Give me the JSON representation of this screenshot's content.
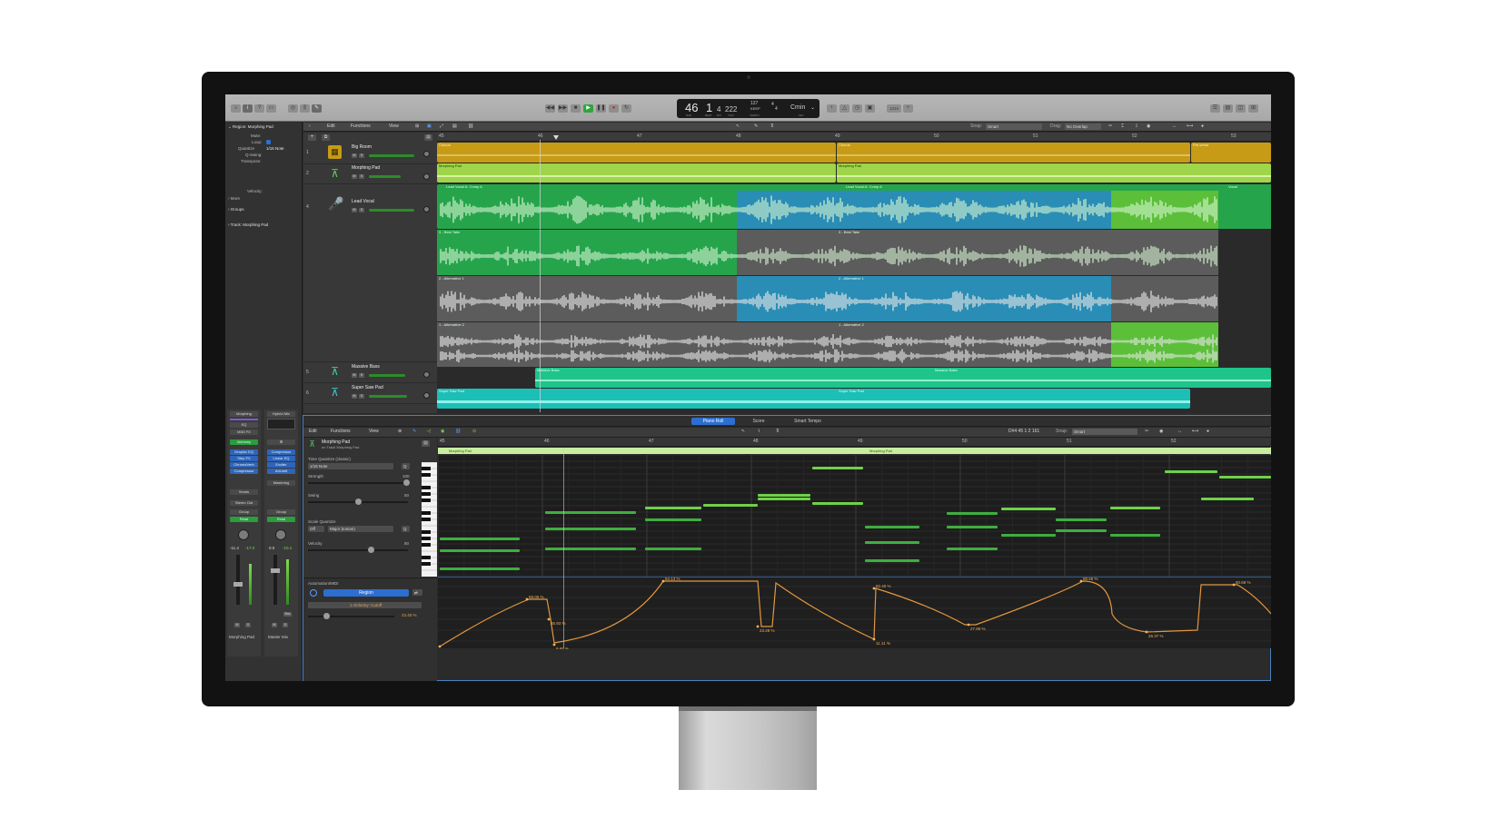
{
  "colors": {
    "accent": "#2d6ed1",
    "chorus": "#c79b16",
    "morph": "#9ed54a",
    "vocal_green": "#26a44c",
    "vocal_blue": "#2a8db5",
    "bass": "#1fc48a",
    "supersaw": "#1bbfb6"
  },
  "control_bar": {
    "position": {
      "bars": "46",
      "beats": "1",
      "div": "4",
      "ticks": "222"
    },
    "position_labels": {
      "bar": "BAR",
      "beat": "BEAT",
      "div": "DIV",
      "tick": "TICK"
    },
    "tempo": "127",
    "tempo_mode": "KEEP",
    "tempo_label": "TEMPO",
    "signature_top": "4",
    "signature_bottom": "4",
    "key": "Cmin",
    "key_label": "KEY",
    "cpu": "1234"
  },
  "tracks_toolbar": {
    "edit": "Edit",
    "functions": "Functions",
    "view": "View",
    "snap_label": "Snap:",
    "snap": "Smart",
    "drag_label": "Drag:",
    "drag": "No Overlap"
  },
  "inspector": {
    "region_header": "Region: Morphing Pad",
    "rows": [
      "Mute:",
      "Loop:",
      "Quantize",
      "Q-Swing:",
      "Transpose:",
      "Velocity:"
    ],
    "quantize_value": "1/16 Note",
    "more": "More",
    "groups": "Groups",
    "track_header": "Track: Morphing Pad"
  },
  "channel_strips": [
    {
      "setting": "Morphing",
      "eq": "EQ",
      "midi_fx": "MIDI FX",
      "instrument": "Alchemy",
      "plugins": [
        "Graphic EQ",
        "Step FX",
        "ChromaVerb",
        "Compressor"
      ],
      "send": "Sends",
      "output": "Stereo Out",
      "group": "Group",
      "automation": "Read",
      "vol": "-11.4",
      "pan": "-17.0",
      "name": "Morphing Pad"
    },
    {
      "setting": "Hybrid Mix",
      "eq": "",
      "midi_fx": "",
      "instrument": "",
      "plugins": [
        "Compressor",
        "Linear EQ",
        "Exciter",
        "AdLimit"
      ],
      "send": "Mastering",
      "output": "",
      "group": "Group",
      "automation": "Read",
      "vol": "0.0",
      "pan": "-10.1",
      "bnc": "Bnc",
      "name": "Master Mix"
    }
  ],
  "ruler": {
    "bars": [
      "45",
      "46",
      "47",
      "48",
      "49",
      "50",
      "51",
      "52",
      "53"
    ]
  },
  "tracks": [
    {
      "num": "1",
      "name": "Big Room"
    },
    {
      "num": "2",
      "name": "Morphing Pad"
    },
    {
      "num": "4",
      "name": "Lead Vocal"
    },
    {
      "num": "5",
      "name": "Massive Bass"
    },
    {
      "num": "6",
      "name": "Super Saw Pad"
    }
  ],
  "regions": {
    "chorus1": "Chorus",
    "chorus2": "Chorus",
    "preverse": "Pre-verse",
    "morph1": "Morphing Pad",
    "morph2": "Morphing Pad",
    "comp1": "Lead Vocal A: Comp A",
    "comp2": "Lead Vocal A: Comp A",
    "comp3": "Vocal",
    "take3a": "3 - Best Take",
    "take3b": "3 - Best Take",
    "take2a": "2 - Alternative 1",
    "take2b": "2 - Alternative 1",
    "take1a": "1 - Alternative 2",
    "take1b": "1 - Alternative 2",
    "bass1": "Massive Bass",
    "bass2": "Massive Bass",
    "saw1": "Super Saw Pad",
    "saw2": "Super Saw Pad"
  },
  "editor": {
    "tabs": [
      "Piano Roll",
      "Score",
      "Smart Tempo"
    ],
    "toolbar": {
      "edit": "Edit",
      "functions": "Functions",
      "view": "View",
      "pos": "D#4  45 1 2 161",
      "snap_label": "Snap:",
      "snap": "Smart"
    },
    "region_name": "Morphing Pad",
    "region_sub": "on Track Morphing Pad",
    "time_quantize_label": "Time Quantize (classic)",
    "time_quantize": "1/16 Note",
    "q": "Q",
    "strength_label": "Strength",
    "strength": "100",
    "swing_label": "Swing",
    "swing": "50",
    "scale_quantize_label": "Scale Quantize",
    "scale_off": "Off",
    "scale": "Major (Ionian)",
    "velocity_label": "Velocity",
    "velocity": "80",
    "automation_label": "Automation/MIDI",
    "automation_mode": "Region",
    "automation_param": "1 Alchemy: Cutoff",
    "automation_value": "23.40 %",
    "ruler": [
      "45",
      "46",
      "47",
      "48",
      "49",
      "50",
      "51",
      "52"
    ],
    "region_labels": [
      "Morphing Pad",
      "Morphing Pad"
    ],
    "auto_points": [
      "59.05 %",
      "35.93 %",
      "9.93 %",
      "9.65 %",
      "84.13 %",
      "23.28 %",
      "82.40 %",
      "11.11 %",
      "27.86 %",
      "88.66 %",
      "26.37 %",
      "80.68 %"
    ]
  }
}
